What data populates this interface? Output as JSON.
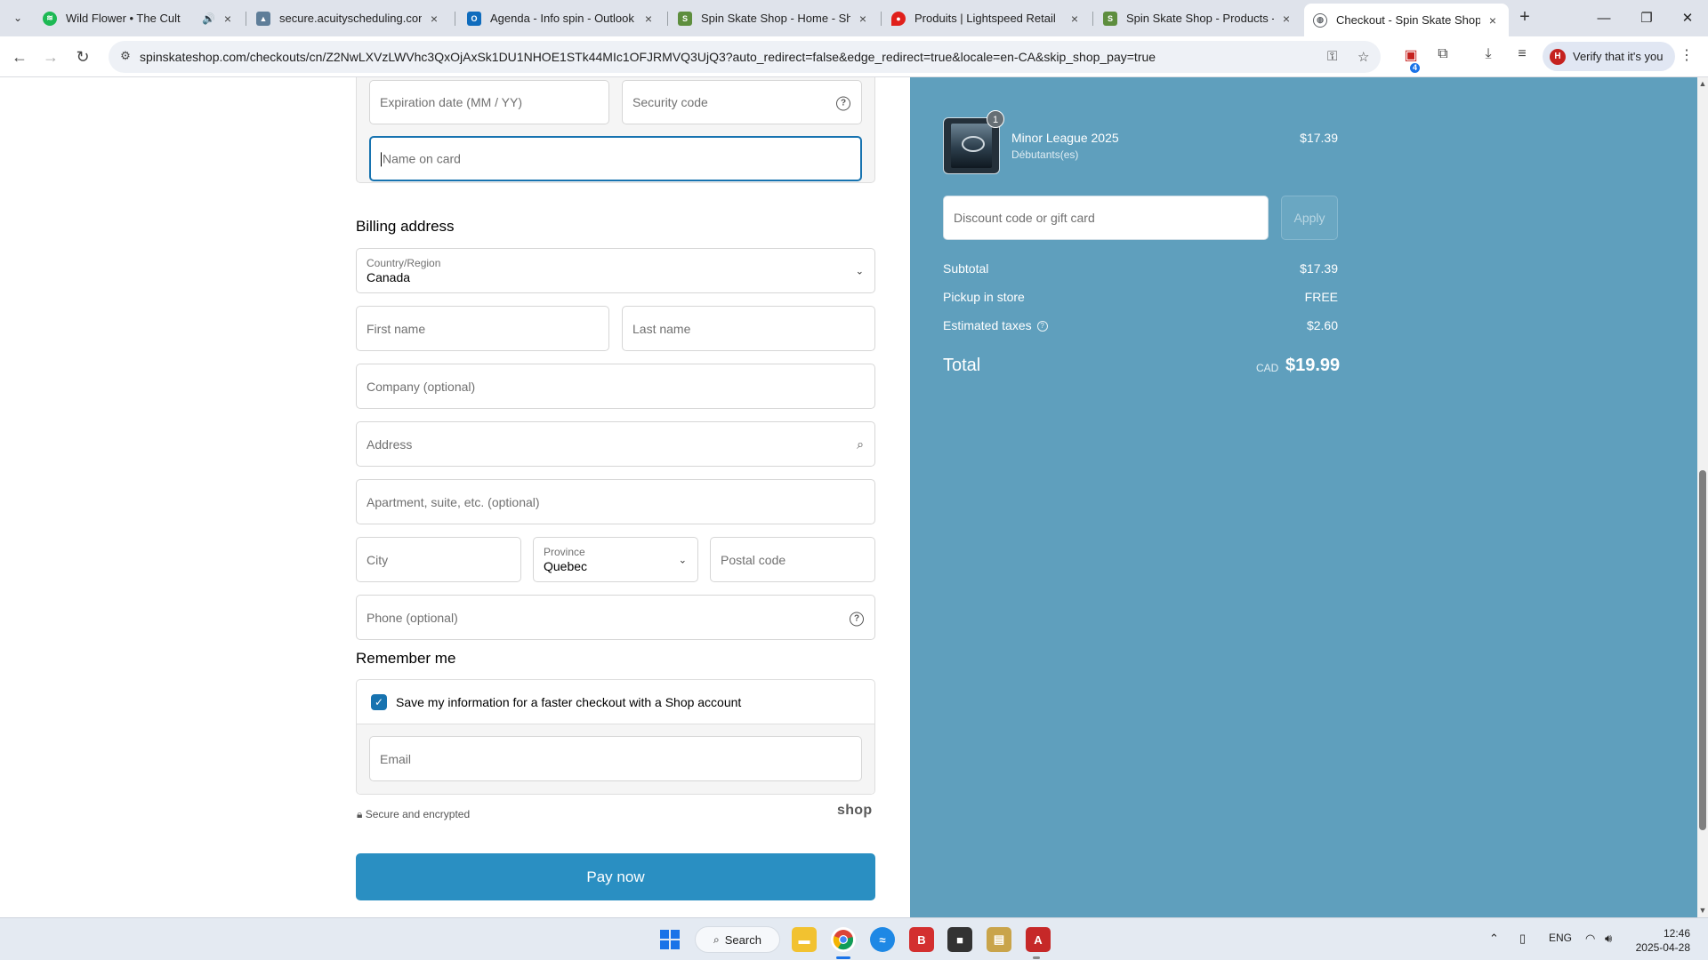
{
  "browser": {
    "tabs": [
      {
        "title": "Wild Flower • The Cult",
        "favicon": "spotify-icon",
        "color": "#1db954",
        "audio": true
      },
      {
        "title": "secure.acuityscheduling.com/ap",
        "favicon": "acuity-icon",
        "color": "#5f7e99"
      },
      {
        "title": "Agenda - Info spin - Outlook",
        "favicon": "outlook-icon",
        "color": "#0f6cbd"
      },
      {
        "title": "Spin Skate Shop - Home - Shop",
        "favicon": "shopify-icon",
        "color": "#5e8e3e"
      },
      {
        "title": "Produits | Lightspeed Retail",
        "favicon": "lightspeed-icon",
        "color": "#e0201b"
      },
      {
        "title": "Spin Skate Shop - Products - M",
        "favicon": "shopify-icon",
        "color": "#5e8e3e"
      },
      {
        "title": "Checkout - Spin Skate Shop",
        "favicon": "globe-icon",
        "color": "#5f6368",
        "active": true
      }
    ],
    "url": "spinskateshop.com/checkouts/cn/Z2NwLXVzLWVhc3QxOjAxSk1DU1NHOE1STk44MIc1OFJRMVQ3UjQ3?auto_redirect=false&edge_redirect=true&locale=en-CA&skip_shop_pay=true",
    "verify_label": "Verify that it's you",
    "verify_avatar": "H",
    "extension_badge": "4"
  },
  "payment": {
    "expiration_placeholder": "Expiration date (MM / YY)",
    "security_placeholder": "Security code",
    "name_placeholder": "Name on card"
  },
  "billing": {
    "title": "Billing address",
    "country_label": "Country/Region",
    "country_value": "Canada",
    "first_name_placeholder": "First name",
    "last_name_placeholder": "Last name",
    "company_placeholder": "Company (optional)",
    "address_placeholder": "Address",
    "apartment_placeholder": "Apartment, suite, etc. (optional)",
    "city_placeholder": "City",
    "province_label": "Province",
    "province_value": "Quebec",
    "postal_placeholder": "Postal code",
    "phone_placeholder": "Phone (optional)"
  },
  "remember": {
    "title": "Remember me",
    "checkbox_label": "Save my information for a faster checkout with a Shop account",
    "checked": true,
    "email_placeholder": "Email",
    "secure_text": "Secure and encrypted",
    "shop_logo": "shop"
  },
  "pay_button": "Pay now",
  "summary": {
    "item": {
      "name": "Minor League 2025",
      "variant": "Débutants(es)",
      "price": "$17.39",
      "quantity": "1"
    },
    "discount_placeholder": "Discount code or gift card",
    "apply_label": "Apply",
    "subtotal_label": "Subtotal",
    "subtotal_value": "$17.39",
    "pickup_label": "Pickup in store",
    "pickup_value": "FREE",
    "taxes_label": "Estimated taxes",
    "taxes_value": "$2.60",
    "total_label": "Total",
    "total_currency": "CAD",
    "total_value": "$19.99"
  },
  "taskbar": {
    "search_label": "Search",
    "language": "ENG",
    "time": "12:46",
    "date": "2025-04-28"
  },
  "colors": {
    "accent": "#1773b0",
    "pay_button": "#2a8fc2",
    "summary_panel": "#5f9fbd"
  }
}
